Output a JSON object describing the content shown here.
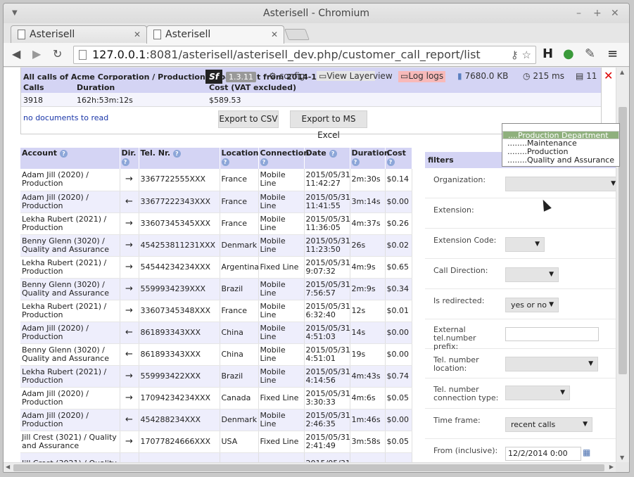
{
  "window": {
    "title": "Asterisell - Chromium"
  },
  "tabs": [
    {
      "label": "Asterisell"
    },
    {
      "label": "Asterisell"
    }
  ],
  "address": {
    "host": "127.0.0.1",
    "port_path": ":8081/asterisell/asterisell_dev.php/customer_call_report/list"
  },
  "sfbar": {
    "logo": "Sf",
    "version": "1.3.11",
    "config": "config",
    "view_layer": "View Layer",
    "view": "view",
    "log": "Log",
    "logs": "logs",
    "memory": "7680.0 KB",
    "time": "215 ms",
    "queries": "11"
  },
  "summary": {
    "title": "All calls of Acme Corporation / Production Department from 2014-12-02",
    "headers": {
      "calls": "Calls",
      "duration": "Duration",
      "cost": "Cost (VAT excluded)"
    },
    "values": {
      "calls": "3918",
      "duration": "162h:53m:12s",
      "cost": "$589.53"
    },
    "docs": "no documents to read",
    "export_csv": "Export to CSV",
    "export_excel": "Export to MS Excel"
  },
  "table": {
    "headers": [
      "Account",
      "Dir.",
      "Tel. Nr.",
      "Location",
      "Connection",
      "Date",
      "Duration",
      "Cost"
    ],
    "rows": [
      {
        "account": "Adam Jill (2020) / Production",
        "dir": "→",
        "tel": "3367722555XXX",
        "loc": "France",
        "conn": "Mobile Line",
        "date": "2015/05/31, 11:42:27",
        "dur": "2m:30s",
        "cost": "$0.14"
      },
      {
        "account": "Adam Jill (2020) / Production",
        "dir": "←",
        "tel": "33677222343XXX",
        "loc": "France",
        "conn": "Mobile Line",
        "date": "2015/05/31, 11:41:55",
        "dur": "3m:14s",
        "cost": "$0.00"
      },
      {
        "account": "Lekha Rubert (2021) / Production",
        "dir": "→",
        "tel": "33607345345XXX",
        "loc": "France",
        "conn": "Mobile Line",
        "date": "2015/05/31, 11:36:05",
        "dur": "4m:37s",
        "cost": "$0.26"
      },
      {
        "account": "Benny Glenn (3020) / Quality and Assurance",
        "dir": "→",
        "tel": "454253811231XXX",
        "loc": "Denmark",
        "conn": "Mobile Line",
        "date": "2015/05/31, 11:23:50",
        "dur": "26s",
        "cost": "$0.02"
      },
      {
        "account": "Lekha Rubert (2021) / Production",
        "dir": "→",
        "tel": "54544234234XXX",
        "loc": "Argentina",
        "conn": "Fixed Line",
        "date": "2015/05/31, 9:07:32",
        "dur": "4m:9s",
        "cost": "$0.65"
      },
      {
        "account": "Benny Glenn (3020) / Quality and Assurance",
        "dir": "→",
        "tel": "5599934239XXX",
        "loc": "Brazil",
        "conn": "Mobile Line",
        "date": "2015/05/31, 7:56:57",
        "dur": "2m:9s",
        "cost": "$0.34"
      },
      {
        "account": "Lekha Rubert (2021) / Production",
        "dir": "→",
        "tel": "33607345348XXX",
        "loc": "France",
        "conn": "Mobile Line",
        "date": "2015/05/31, 6:32:40",
        "dur": "12s",
        "cost": "$0.01"
      },
      {
        "account": "Adam Jill (2020) / Production",
        "dir": "←",
        "tel": "861893343XXX",
        "loc": "China",
        "conn": "Mobile Line",
        "date": "2015/05/31, 4:51:03",
        "dur": "14s",
        "cost": "$0.00"
      },
      {
        "account": "Benny Glenn (3020) / Quality and Assurance",
        "dir": "←",
        "tel": "861893343XXX",
        "loc": "China",
        "conn": "Mobile Line",
        "date": "2015/05/31, 4:51:01",
        "dur": "19s",
        "cost": "$0.00"
      },
      {
        "account": "Lekha Rubert (2021) / Production",
        "dir": "→",
        "tel": "559993422XXX",
        "loc": "Brazil",
        "conn": "Mobile Line",
        "date": "2015/05/31, 4:14:56",
        "dur": "4m:43s",
        "cost": "$0.74"
      },
      {
        "account": "Adam Jill (2020) / Production",
        "dir": "→",
        "tel": "17094234234XXX",
        "loc": "Canada",
        "conn": "Fixed Line",
        "date": "2015/05/31, 3:30:33",
        "dur": "4m:6s",
        "cost": "$0.05"
      },
      {
        "account": "Adam Jill (2020) / Production",
        "dir": "←",
        "tel": "454288234XXX",
        "loc": "Denmark",
        "conn": "Mobile Line",
        "date": "2015/05/31, 2:46:35",
        "dur": "1m:46s",
        "cost": "$0.00"
      },
      {
        "account": "Jill Crest (3021) / Quality and Assurance",
        "dir": "→",
        "tel": "17077824666XXX",
        "loc": "USA",
        "conn": "Fixed Line",
        "date": "2015/05/31, 2:41:49",
        "dur": "3m:58s",
        "cost": "$0.05"
      },
      {
        "account": "Jill Crest (3021) / Quality",
        "dir": "",
        "tel": "",
        "loc": "",
        "conn": "",
        "date": "2015/05/31,",
        "dur": "",
        "cost": "-"
      }
    ]
  },
  "filters": {
    "title": "filters",
    "organization": "Organization:",
    "extension": "Extension:",
    "extension_code": "Extension Code:",
    "call_direction": "Call Direction:",
    "is_redirected": "Is redirected:",
    "is_redirected_value": "yes or no",
    "external_prefix": "External tel.number prefix:",
    "tel_location": "Tel. number location:",
    "tel_connection": "Tel. number connection type:",
    "time_frame": "Time frame:",
    "time_frame_value": "recent calls",
    "from": "From (inclusive):",
    "from_value": "12/2/2014 0:00"
  },
  "dropdown": {
    "options": [
      "....Production Department",
      "........Maintenance",
      "........Production",
      "........Quality and Assurance"
    ],
    "selected_index": 0
  }
}
